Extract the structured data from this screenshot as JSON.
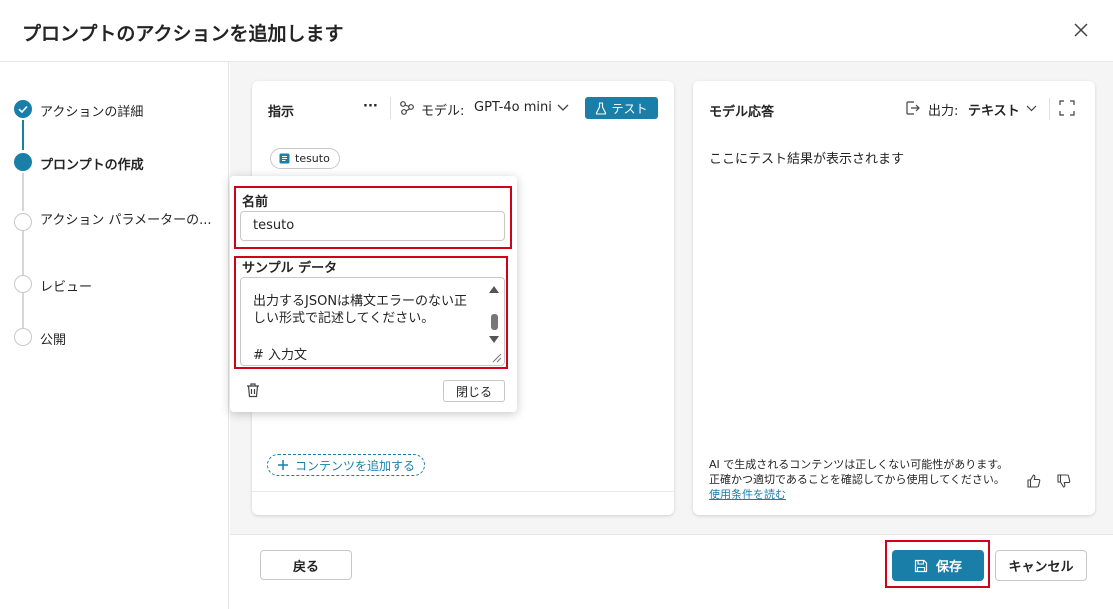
{
  "dialog": {
    "title": "プロンプトのアクションを追加します"
  },
  "steps": [
    {
      "label": "アクションの詳細",
      "state": "done"
    },
    {
      "label": "プロンプトの作成",
      "state": "active"
    },
    {
      "label": "アクション パラメーターの...",
      "state": "pending"
    },
    {
      "label": "レビュー",
      "state": "pending"
    },
    {
      "label": "公開",
      "state": "pending"
    }
  ],
  "instructions": {
    "title": "指示",
    "more": "···",
    "model_label": "モデル:",
    "model_value": "GPT-4o mini",
    "test_label": "テスト",
    "chip_label": "tesuto",
    "add_content_label": "コンテンツを追加する"
  },
  "popover": {
    "name_label": "名前",
    "name_value": "tesuto",
    "sample_label": "サンプル データ",
    "sample_lines": [
      "出力するJSONは構文エラーのない正",
      "しい形式で記述してください。",
      "",
      "# 入力文"
    ],
    "close_label": "閉じる"
  },
  "response": {
    "title": "モデル応答",
    "output_label": "出力:",
    "output_value": "テキスト",
    "placeholder": "ここにテスト結果が表示されます",
    "disclaimer": "AI で生成されるコンテンツは正しくない可能性があります。正確かつ適切であることを確認してから使用してください。",
    "terms_link": "使用条件を読む"
  },
  "footer": {
    "back_label": "戻る",
    "save_label": "保存",
    "cancel_label": "キャンセル"
  },
  "colors": {
    "accent": "#1a7fa8",
    "highlight": "#d0021b"
  }
}
